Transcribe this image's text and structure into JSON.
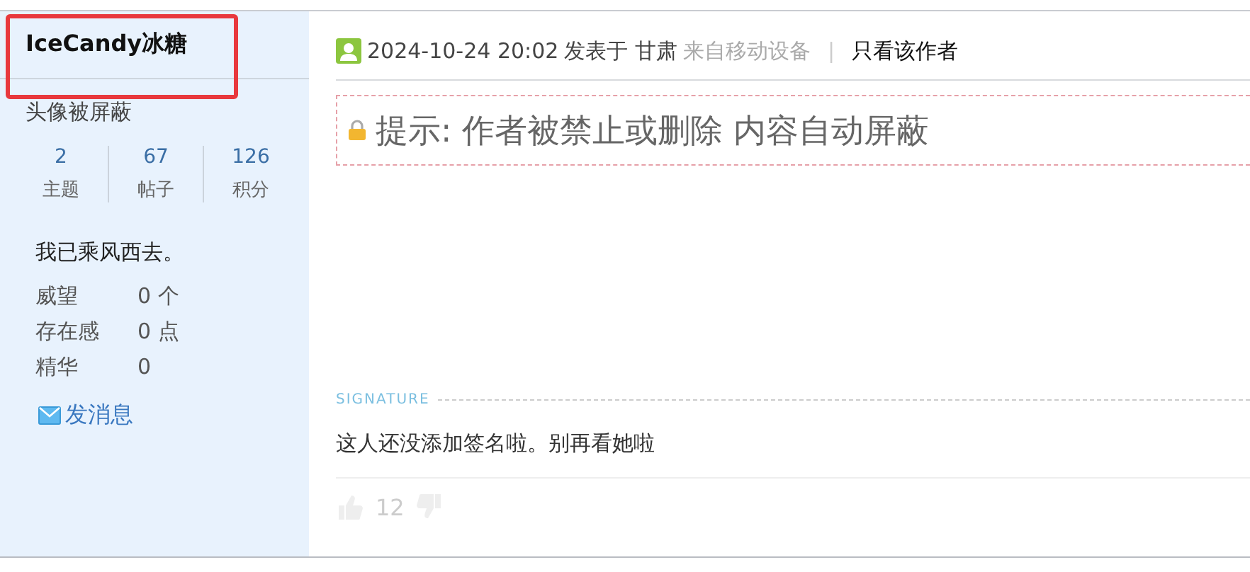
{
  "author": {
    "name": "IceCandy冰糖",
    "highlighted": true,
    "avatar_note": "头像被屏蔽",
    "stats": [
      {
        "value": "2",
        "label": "主题"
      },
      {
        "value": "67",
        "label": "帖子"
      },
      {
        "value": "126",
        "label": "积分"
      }
    ],
    "motto": "我已乘风西去。",
    "fields": [
      {
        "label": "威望",
        "value": "0 个"
      },
      {
        "label": "存在感",
        "value": "0 点"
      },
      {
        "label": "精华",
        "value": "0"
      }
    ],
    "message_link": "发消息"
  },
  "post": {
    "timestamp": "2024-10-24 20:02",
    "posted_in": "发表于 甘肃",
    "source": "来自移动设备",
    "separator": "|",
    "author_only": "只看该作者",
    "notice": "提示: 作者被禁止或删除 内容自动屏蔽",
    "signature_label": "SIGNATURE",
    "signature": "这人还没添加签名啦。别再看她啦",
    "likes": "12"
  }
}
